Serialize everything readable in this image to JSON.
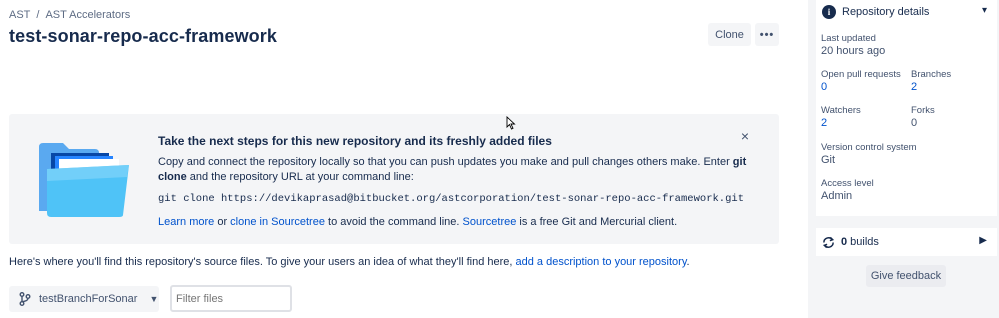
{
  "breadcrumb": {
    "root": "AST",
    "separator": "/",
    "project": "AST Accelerators"
  },
  "repo": {
    "title": "test-sonar-repo-acc-framework"
  },
  "actions": {
    "clone_label": "Clone",
    "more_label": "•••"
  },
  "onboarding": {
    "heading": "Take the next steps for this new repository and its freshly added files",
    "desc_part1": "Copy and connect the repository locally so that you can push updates you make and pull changes others make. Enter ",
    "desc_bold": "git clone",
    "desc_part2": " and the repository URL at your command line:",
    "command": "git clone https://devikaprasad@bitbucket.org/astcorporation/test-sonar-repo-acc-framework.git",
    "learn_more": "Learn more",
    "or_text": " or ",
    "sourcetree_clone": "clone in Sourcetree",
    "avoid_text": " to avoid the command line. ",
    "sourcetree": "Sourcetree",
    "free_client_text": " is a free Git and Mercurial client.",
    "close_icon": "×"
  },
  "source_files": {
    "text": "Here's where you'll find this repository's source files. To give your users an idea of what they'll find here, ",
    "link": "add a description to your repository",
    "end": "."
  },
  "branch_selector": {
    "label": "testBranchForSonar",
    "chevron": "⌄"
  },
  "filter": {
    "placeholder": "Filter files"
  },
  "sidebar": {
    "details_title": "Repository details",
    "last_updated_label": "Last updated",
    "last_updated_value": "20 hours ago",
    "open_prs_label": "Open pull requests",
    "open_prs_value": "0",
    "branches_label": "Branches",
    "branches_value": "2",
    "watchers_label": "Watchers",
    "watchers_value": "2",
    "forks_label": "Forks",
    "forks_value": "0",
    "vcs_label": "Version control system",
    "vcs_value": "Git",
    "access_label": "Access level",
    "access_value": "Admin",
    "builds_count": "0",
    "builds_label": " builds",
    "feedback_label": "Give feedback"
  },
  "colors": {
    "link": "#0052cc",
    "text": "#172b4d",
    "panel_bg": "#f4f5f7"
  }
}
